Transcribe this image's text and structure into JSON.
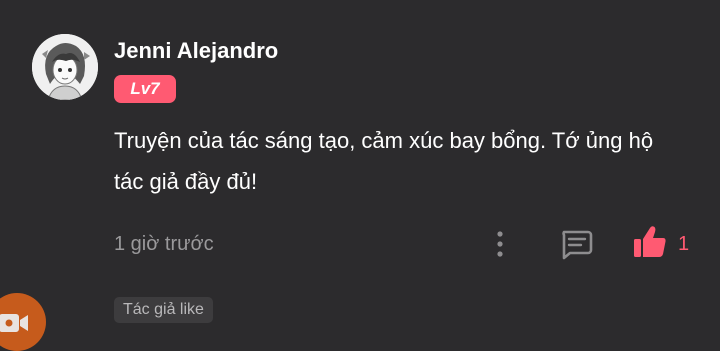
{
  "comment": {
    "user": {
      "name": "Jenni Alejandro",
      "level": "Lv7"
    },
    "text": "Truyện của tác sáng tạo, cảm xúc bay bổng. Tớ ủng hộ tác giả đầy đủ!",
    "timestamp": "1 giờ trước",
    "likes": "1",
    "author_like_label": "Tác giả like"
  },
  "icons": {
    "more": "more-vertical-icon",
    "reply": "comment-icon",
    "like": "thumbs-up-icon",
    "video": "video-camera-icon"
  },
  "colors": {
    "background": "#2c2b2d",
    "accent": "#ff5a72",
    "muted_text": "#9a999b",
    "floating_button": "#c65b1c"
  }
}
